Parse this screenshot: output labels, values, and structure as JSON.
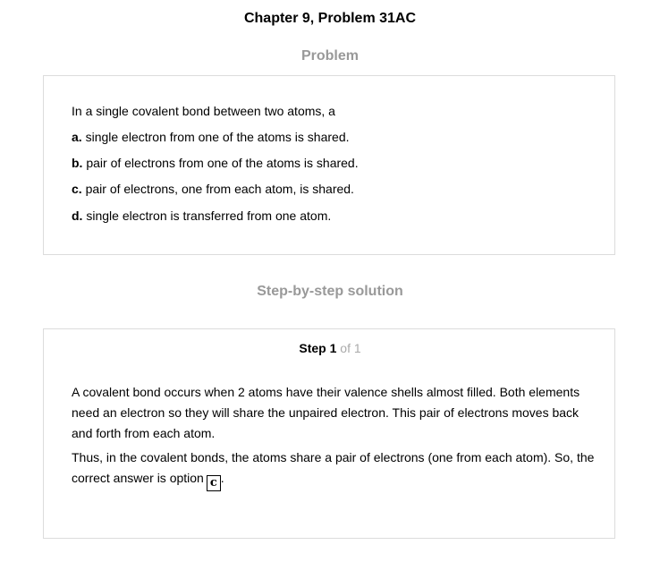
{
  "header": {
    "title": "Chapter 9, Problem 31AC"
  },
  "problem": {
    "heading": "Problem",
    "stem": "In a single covalent bond between two atoms, a",
    "options": [
      {
        "letter": "a.",
        "text": "single electron from one of the atoms is shared."
      },
      {
        "letter": "b.",
        "text": "pair of electrons from one of the atoms is shared."
      },
      {
        "letter": "c.",
        "text": "pair of electrons, one from each atom, is shared."
      },
      {
        "letter": "d.",
        "text": "single electron is transferred from one atom."
      }
    ]
  },
  "solution": {
    "heading": "Step-by-step solution",
    "step_label": "Step",
    "step_number": "1",
    "step_of": "of 1",
    "paragraph1": "A covalent bond occurs when 2 atoms have their valence shells almost filled. Both elements need an electron so they will share the unpaired electron. This pair of electrons moves back and forth from each atom.",
    "paragraph2_text": "Thus, in the covalent bonds, the atoms share a pair of electrons (one from each atom). So, the correct answer is option",
    "answer": "c",
    "paragraph2_end": "."
  }
}
